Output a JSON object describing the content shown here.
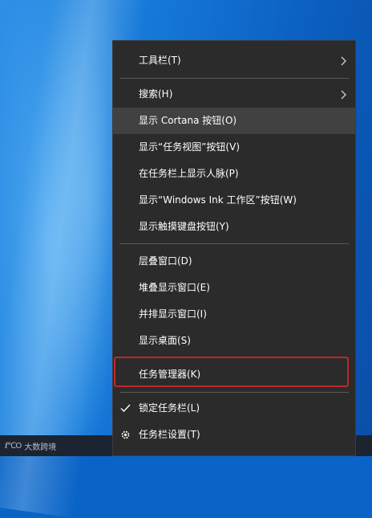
{
  "menu": {
    "items": [
      {
        "label": "工具栏(T)"
      },
      {
        "label": "搜索(H)"
      },
      {
        "label": "显示 Cortana 按钮(O)"
      },
      {
        "label": "显示“任务视图”按钮(V)"
      },
      {
        "label": "在任务栏上显示人脉(P)"
      },
      {
        "label": "显示“Windows Ink 工作区”按钮(W)"
      },
      {
        "label": "显示触摸键盘按钮(Y)"
      },
      {
        "label": "层叠窗口(D)"
      },
      {
        "label": "堆叠显示窗口(E)"
      },
      {
        "label": "并排显示窗口(I)"
      },
      {
        "label": "显示桌面(S)"
      },
      {
        "label": "任务管理器(K)"
      },
      {
        "label": "锁定任务栏(L)"
      },
      {
        "label": "任务栏设置(T)"
      }
    ]
  },
  "watermark": {
    "logo": "ℓ℃O",
    "text": "大数跨境"
  },
  "colors": {
    "menu_bg": "#2b2b2b",
    "hover_bg": "#414141",
    "highlight_box": "#c0262a"
  }
}
